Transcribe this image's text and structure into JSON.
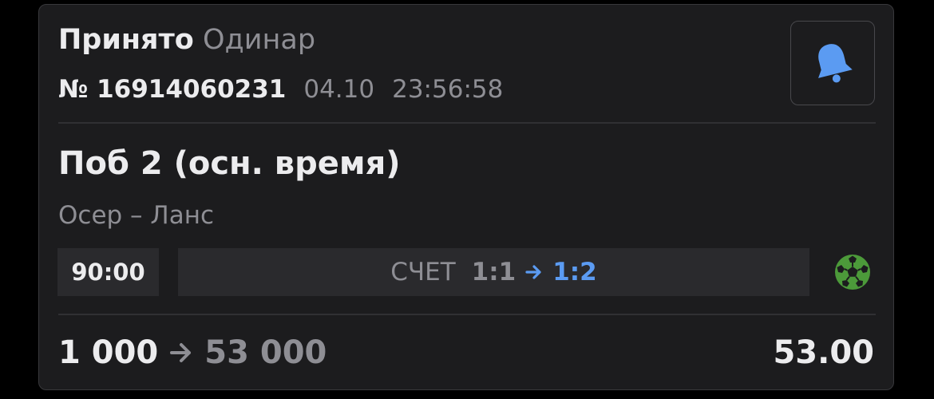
{
  "bet": {
    "status": "Принято",
    "type": "Одинар",
    "number": "№ 16914060231",
    "date": "04.10",
    "time": "23:56:58"
  },
  "notification": {
    "icon": "bell-icon",
    "color": "#5b9bf2"
  },
  "outcome": "Поб 2 (осн. время)",
  "match": "Осер – Ланс",
  "live": {
    "match_time": "90:00",
    "score_label": "СЧЕТ",
    "score_before": "1:1",
    "score_after": "1:2",
    "sport_icon": "soccer-ball-icon",
    "sport_color": "#4c9a3a"
  },
  "amounts": {
    "stake": "1 000",
    "payout": "53 000",
    "coefficient": "53.00"
  },
  "colors": {
    "card_bg": "#1c1c1e",
    "primary_text": "#ececee",
    "secondary_text": "#8e8e94",
    "accent": "#5b9bf2"
  }
}
